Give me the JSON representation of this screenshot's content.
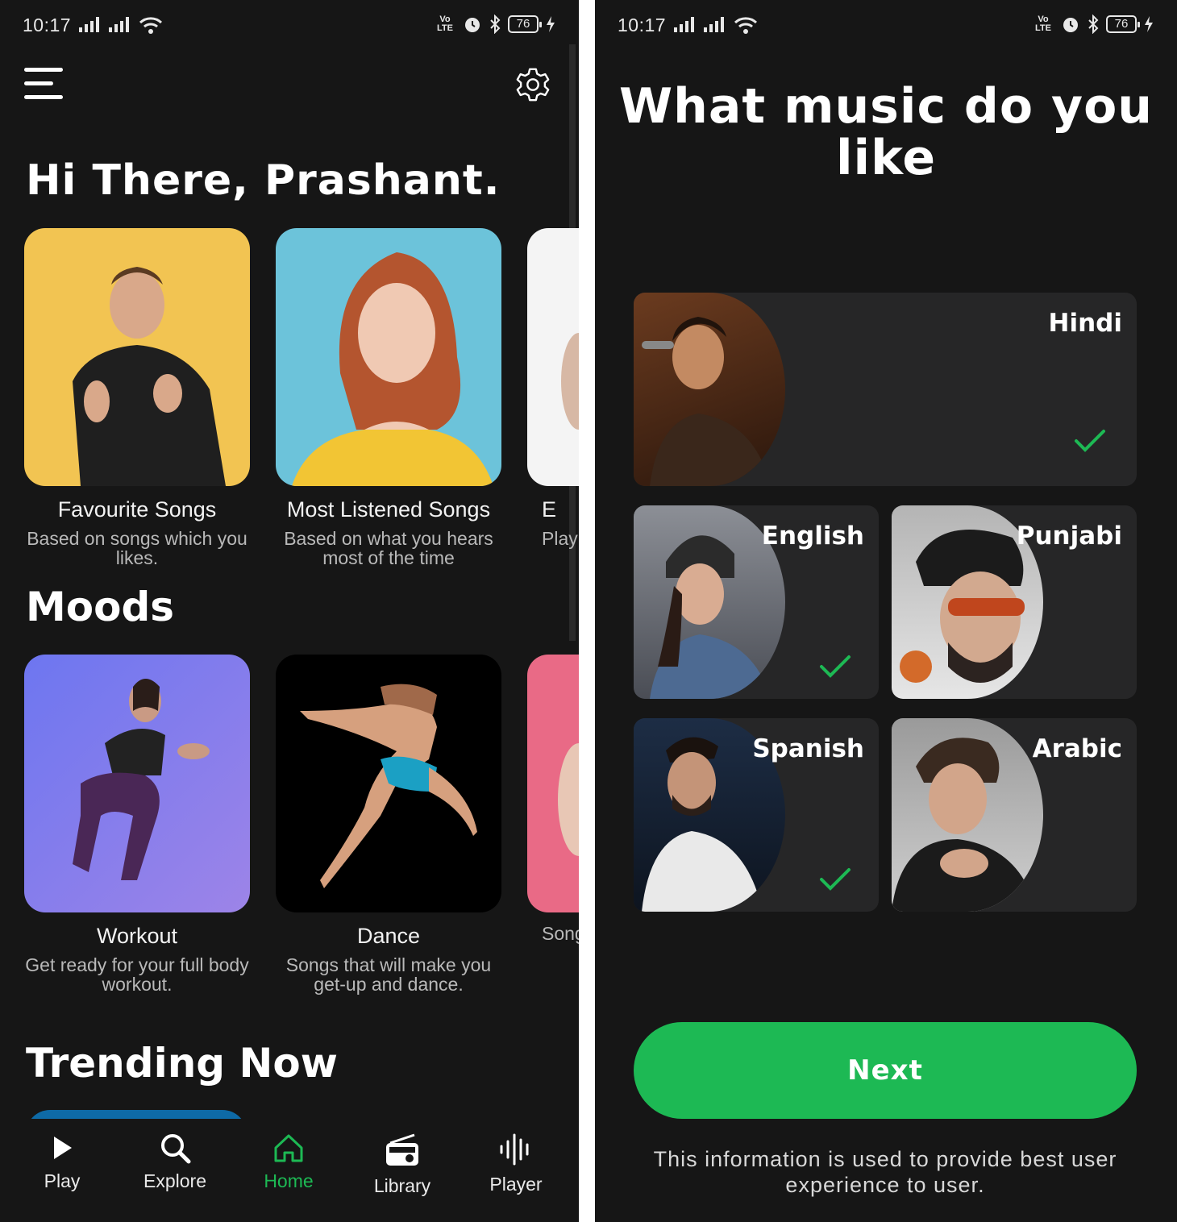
{
  "status_bar": {
    "time": "10:17",
    "battery": "76",
    "network": "VoLTE"
  },
  "home": {
    "greeting": "Hi There, Prashant.",
    "playlists": [
      {
        "title": "Favourite Songs",
        "subtitle": "Based on songs which you likes."
      },
      {
        "title": "Most Listened Songs",
        "subtitle": "Based on what you hears most of the time"
      },
      {
        "title": "E",
        "subtitle": "Play v"
      }
    ],
    "moods_title": "Moods",
    "moods": [
      {
        "title": "Workout",
        "subtitle": "Get ready for your full body workout."
      },
      {
        "title": "Dance",
        "subtitle": "Songs that will make you get-up and dance."
      },
      {
        "title": "",
        "subtitle": "Song rela"
      }
    ],
    "trending_title": "Trending Now",
    "nav": [
      {
        "label": "Play",
        "icon": "play-icon"
      },
      {
        "label": "Explore",
        "icon": "search-icon"
      },
      {
        "label": "Home",
        "icon": "home-icon",
        "active": true
      },
      {
        "label": "Library",
        "icon": "radio-icon"
      },
      {
        "label": "Player",
        "icon": "waveform-icon"
      }
    ],
    "accent": "#1db954"
  },
  "onboarding": {
    "title": "What music do you like",
    "languages": [
      {
        "name": "Hindi",
        "selected": true
      },
      {
        "name": "English",
        "selected": true
      },
      {
        "name": "Punjabi",
        "selected": false
      },
      {
        "name": "Spanish",
        "selected": true
      },
      {
        "name": "Arabic",
        "selected": false
      }
    ],
    "next_label": "Next",
    "info": "This information is used to provide best user experience to user."
  }
}
